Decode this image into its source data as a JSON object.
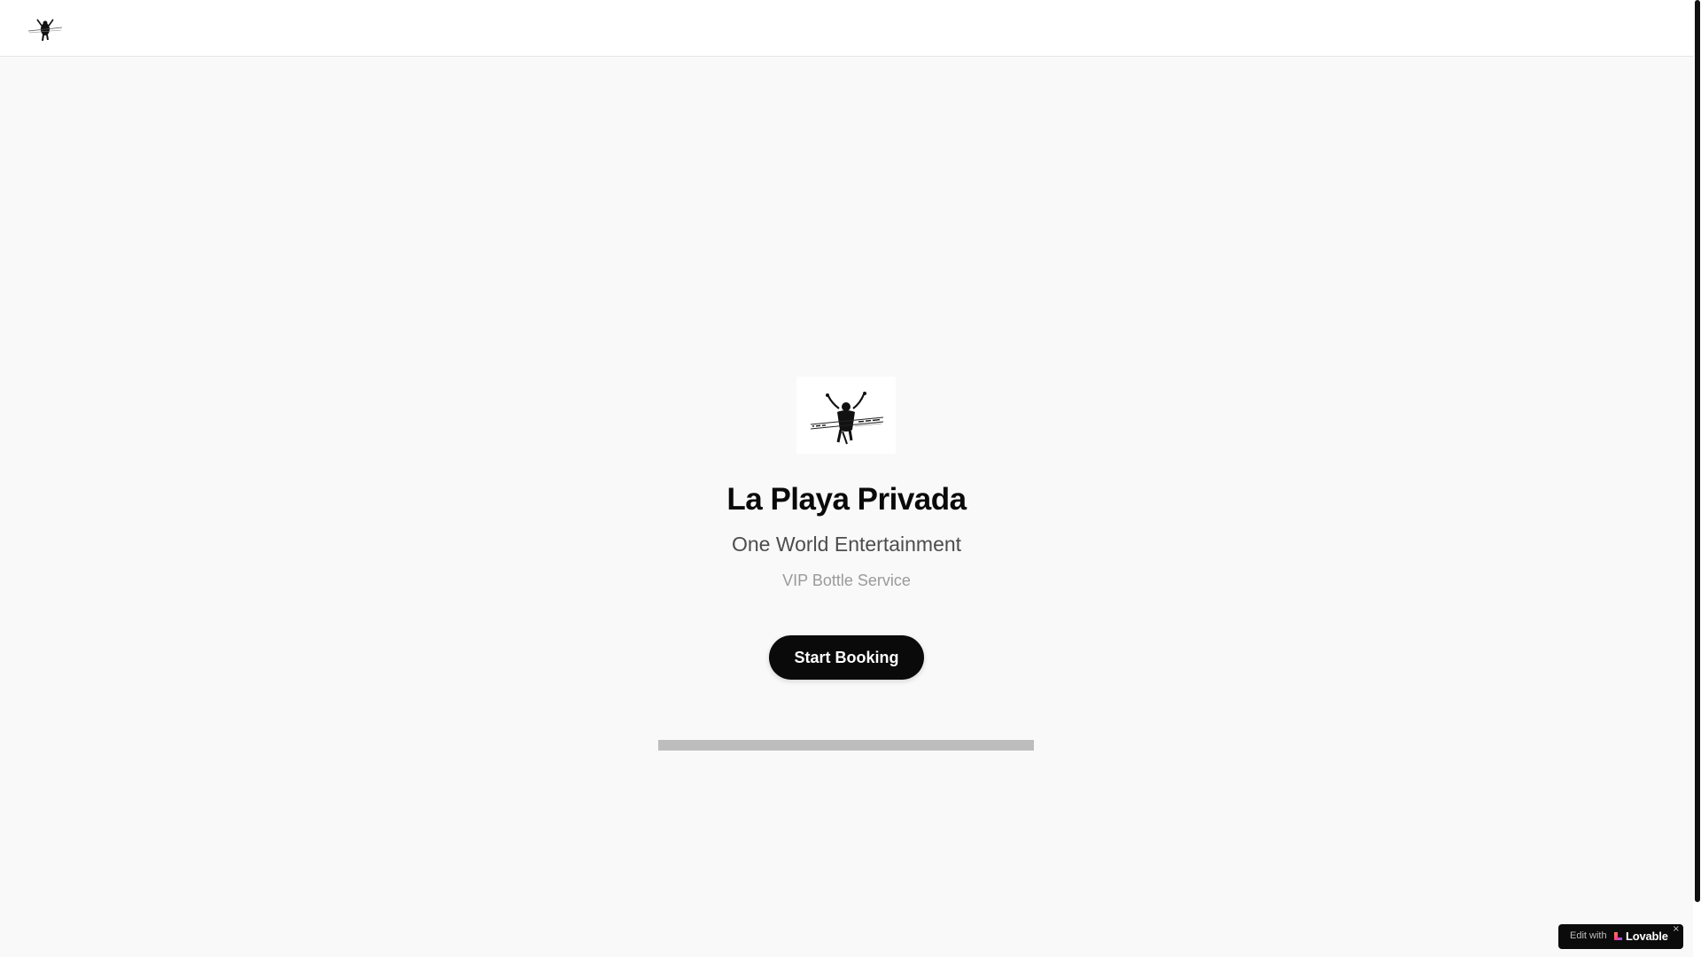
{
  "header": {
    "logo_icon": "one-world-entertainment-logo"
  },
  "hero": {
    "logo_icon": "one-world-entertainment-logo",
    "title": "La Playa Privada",
    "subtitle": "One World Entertainment",
    "tagline": "VIP Bottle Service",
    "start_button_label": "Start Booking"
  },
  "progress": {
    "value_percent": 0
  },
  "badge": {
    "edit_label": "Edit with",
    "brand_label": "Lovable",
    "close_label": "×",
    "brand_icon": "lovable-heart-icon"
  },
  "colors": {
    "background": "#f9f9f9",
    "header_bg": "#ffffff",
    "button_bg": "#0a0a0a",
    "progress_track": "#bdbdbd"
  }
}
